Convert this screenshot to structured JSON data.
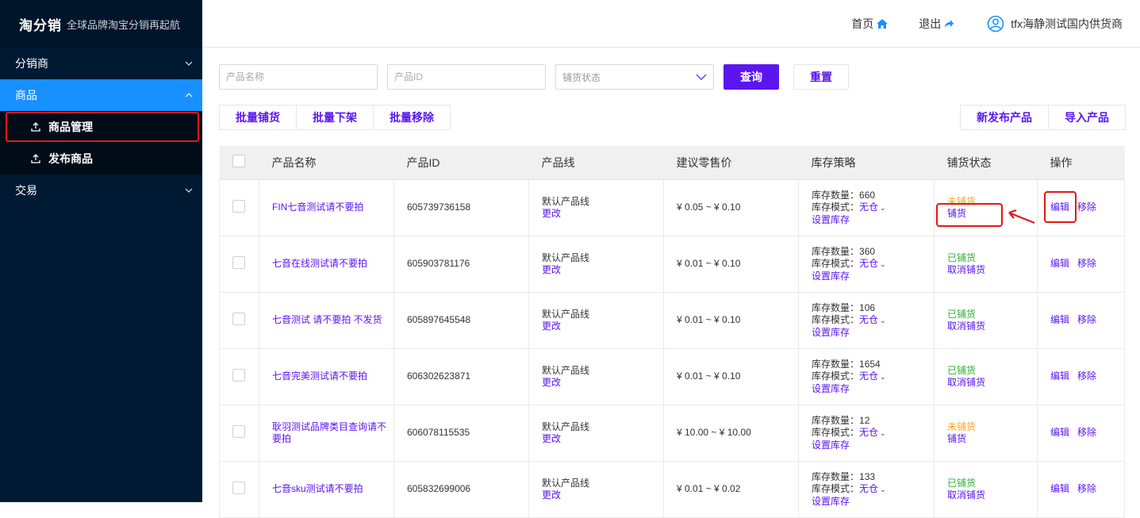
{
  "sidebar": {
    "brand": "淘分销",
    "slogan": "全球品牌淘宝分销再起航",
    "menu": [
      {
        "label": "分销商"
      },
      {
        "label": "商品"
      },
      {
        "label": "交易"
      }
    ],
    "submenu": [
      {
        "label": "商品管理"
      },
      {
        "label": "发布商品"
      }
    ]
  },
  "topbar": {
    "home": "首页",
    "logout": "退出",
    "user": "tfx海静测试国内供货商"
  },
  "filters": {
    "name_placeholder": "产品名称",
    "id_placeholder": "产品ID",
    "status_placeholder": "铺货状态",
    "query": "查询",
    "reset": "重置"
  },
  "actions": {
    "batch_distribute": "批量铺货",
    "batch_offshelf": "批量下架",
    "batch_remove": "批量移除",
    "new_product": "新发布产品",
    "import_product": "导入产品"
  },
  "table": {
    "headers": [
      "产品名称",
      "产品ID",
      "产品线",
      "建议零售价",
      "库存策略",
      "铺货状态",
      "操作"
    ],
    "labels": {
      "line_change": "更改",
      "stock_qty": "库存数量：",
      "stock_mode": "库存模式：",
      "set_stock": "设置库存",
      "edit": "编辑",
      "remove": "移除"
    },
    "rows": [
      {
        "name": "FIN七音测试请不要拍",
        "id": "605739736158",
        "line": "默认产品线",
        "price": "¥ 0.05 ~ ¥ 0.10",
        "qty": "660",
        "mode": "无仓",
        "status": "未铺货",
        "status_action": "铺货"
      },
      {
        "name": "七音在线测试请不要拍",
        "id": "605903781176",
        "line": "默认产品线",
        "price": "¥ 0.01 ~ ¥ 0.10",
        "qty": "360",
        "mode": "无仓",
        "status": "已铺货",
        "status_action": "取消铺货"
      },
      {
        "name": "七音测试 请不要拍 不发货",
        "id": "605897645548",
        "line": "默认产品线",
        "price": "¥ 0.01 ~ ¥ 0.10",
        "qty": "106",
        "mode": "无仓",
        "status": "已铺货",
        "status_action": "取消铺货"
      },
      {
        "name": "七音完美测试请不要拍",
        "id": "606302623871",
        "line": "默认产品线",
        "price": "¥ 0.01 ~ ¥ 0.10",
        "qty": "1654",
        "mode": "无仓",
        "status": "已铺货",
        "status_action": "取消铺货"
      },
      {
        "name": "耿羽测试品牌类目查询请不要拍",
        "id": "606078115535",
        "line": "默认产品线",
        "price": "¥ 10.00 ~ ¥ 10.00",
        "qty": "12",
        "mode": "无仓",
        "status": "未铺货",
        "status_action": "铺货"
      },
      {
        "name": "七音sku测试请不要拍",
        "id": "605832699006",
        "line": "默认产品线",
        "price": "¥ 0.01 ~ ¥ 0.02",
        "qty": "133",
        "mode": "无仓",
        "status": "已铺货",
        "status_action": "取消铺货"
      }
    ]
  },
  "colors": {
    "accent": "#5b16f0",
    "sidebar": "#001a33",
    "active_menu": "#1890ff",
    "highlight": "#e51717",
    "not_distributed": "#f5a623",
    "distributed": "#2db32d"
  }
}
